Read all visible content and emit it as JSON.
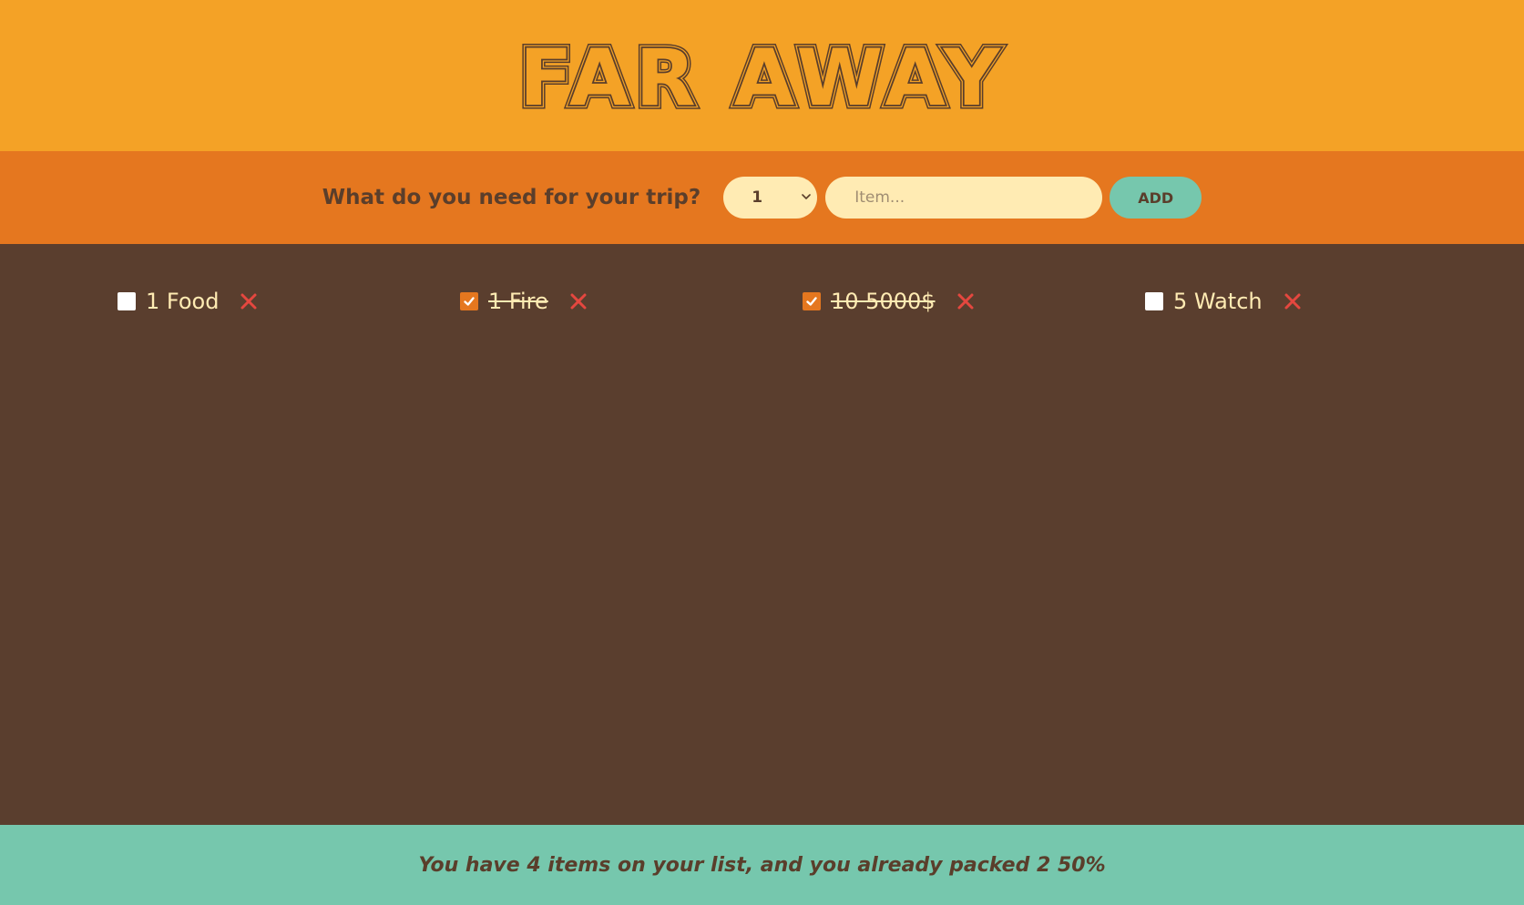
{
  "header": {
    "logo_text": "FAR AWAY"
  },
  "form": {
    "question": "What do you need for your trip?",
    "quantity_selected": "1",
    "item_placeholder": "Item...",
    "add_label": "ADD"
  },
  "items": [
    {
      "quantity": "1",
      "description": "Food",
      "label": "1 Food",
      "packed": false
    },
    {
      "quantity": "1",
      "description": "Fire",
      "label": "1 Fire",
      "packed": true
    },
    {
      "quantity": "10",
      "description": "5000$",
      "label": "10 5000$",
      "packed": true
    },
    {
      "quantity": "5",
      "description": "Watch",
      "label": "5 Watch",
      "packed": false
    }
  ],
  "stats": {
    "text": "You have 4 items on your list, and you already packed 2 50%"
  },
  "colors": {
    "header_bg": "#f4a226",
    "form_bg": "#e5771f",
    "list_bg": "#5a3e2e",
    "footer_bg": "#76c7ad",
    "text_dark": "#5a3e2b",
    "text_light": "#ffebb3",
    "delete_icon": "#e5473f"
  },
  "icons": {
    "delete": "close-x-icon",
    "checked": "checkmark-icon",
    "select": "chevron-down-icon"
  }
}
